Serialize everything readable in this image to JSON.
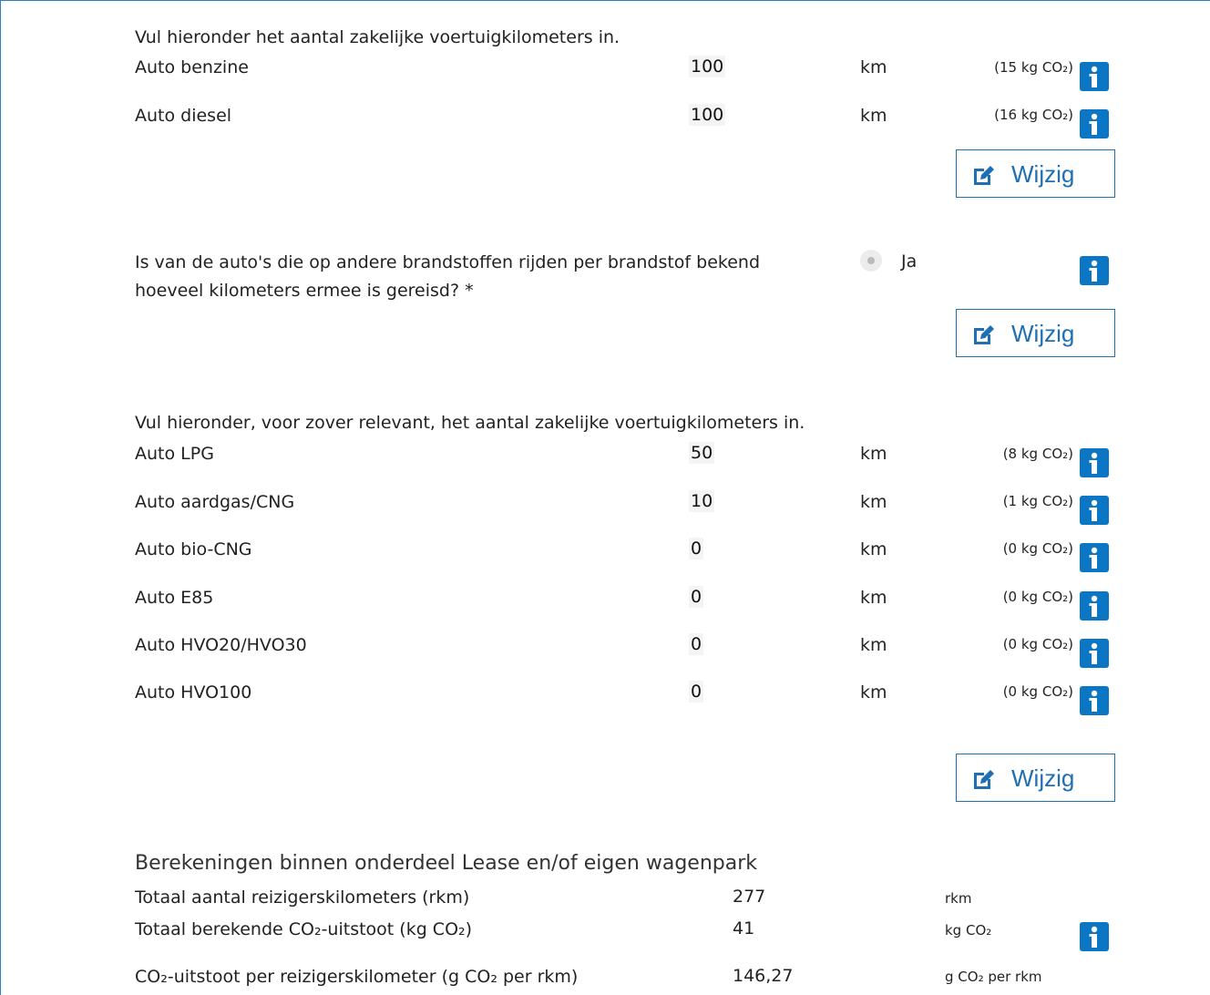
{
  "section1": {
    "intro": "Vul hieronder het aantal zakelijke voertuigkilometers in.",
    "rows": [
      {
        "label": "Auto benzine",
        "value": "100",
        "unit": "km",
        "co2": "(15 kg CO₂)"
      },
      {
        "label": "Auto diesel",
        "value": "100",
        "unit": "km",
        "co2": "(16 kg CO₂)"
      }
    ],
    "edit_label": "Wijzig"
  },
  "question": {
    "line1": "Is van de auto's die op andere brandstoffen rijden per brandstof bekend",
    "line2": "hoeveel kilometers ermee is gereisd? *",
    "answer": "Ja",
    "edit_label": "Wijzig"
  },
  "section2": {
    "intro": "Vul hieronder, voor zover relevant, het aantal zakelijke voertuigkilometers in.",
    "rows": [
      {
        "label": "Auto LPG",
        "value": "50",
        "unit": "km",
        "co2": "(8 kg CO₂)"
      },
      {
        "label": "Auto aardgas/CNG",
        "value": "10",
        "unit": "km",
        "co2": "(1 kg CO₂)"
      },
      {
        "label": "Auto bio-CNG",
        "value": "0",
        "unit": "km",
        "co2": "(0 kg CO₂)"
      },
      {
        "label": "Auto E85",
        "value": "0",
        "unit": "km",
        "co2": "(0 kg CO₂)"
      },
      {
        "label": "Auto HVO20/HVO30",
        "value": "0",
        "unit": "km",
        "co2": "(0 kg CO₂)"
      },
      {
        "label": "Auto HVO100",
        "value": "0",
        "unit": "km",
        "co2": "(0 kg CO₂)"
      }
    ],
    "edit_label": "Wijzig"
  },
  "calculations": {
    "heading": "Berekeningen binnen onderdeel Lease en/of eigen wagenpark",
    "rows": [
      {
        "label": "Totaal aantal reizigerskilometers (rkm)",
        "value": "277",
        "unit": "rkm"
      },
      {
        "label": "Totaal berekende CO₂-uitstoot (kg CO₂)",
        "value": "41",
        "unit": "kg CO₂"
      },
      {
        "label": "CO₂-uitstoot per reizigerskilometer (g CO₂ per rkm)",
        "value": "146,27",
        "unit": "g CO₂ per rkm"
      }
    ]
  },
  "icons": {
    "info": "info-icon",
    "edit": "edit-icon",
    "radio": "radio-button"
  },
  "colors": {
    "accent": "#0b76c4",
    "button_border": "#1f6fb5"
  }
}
